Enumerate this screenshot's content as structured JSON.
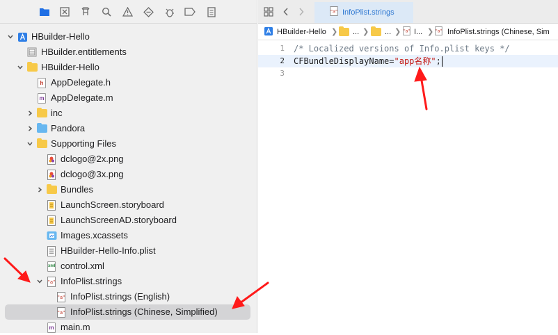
{
  "navigator": {
    "toolbar_icons": [
      "folder-icon",
      "source-control-icon",
      "symbol-icon",
      "search-icon",
      "issue-icon",
      "test-icon",
      "debug-icon",
      "breakpoint-icon",
      "report-icon"
    ],
    "tree": [
      {
        "label": "HBuilder-Hello",
        "icon": "project-icon",
        "expanded": true
      },
      {
        "label": "HBuilder.entitlements",
        "icon": "entitlements-icon"
      },
      {
        "label": "HBuilder-Hello",
        "icon": "folder-icon",
        "expanded": true
      },
      {
        "label": "AppDelegate.h",
        "icon": "header-file-icon",
        "glyph": "h"
      },
      {
        "label": "AppDelegate.m",
        "icon": "objc-file-icon",
        "glyph": "m"
      },
      {
        "label": "inc",
        "icon": "folder-icon",
        "expanded": false
      },
      {
        "label": "Pandora",
        "icon": "blue-folder-icon",
        "expanded": false
      },
      {
        "label": "Supporting Files",
        "icon": "folder-icon",
        "expanded": true
      },
      {
        "label": "dclogo@2x.png",
        "icon": "image-file-icon"
      },
      {
        "label": "dclogo@3x.png",
        "icon": "image-file-icon"
      },
      {
        "label": "Bundles",
        "icon": "folder-icon",
        "expanded": false
      },
      {
        "label": "LaunchScreen.storyboard",
        "icon": "storyboard-icon"
      },
      {
        "label": "LaunchScreenAD.storyboard",
        "icon": "storyboard-icon"
      },
      {
        "label": "Images.xcassets",
        "icon": "asset-catalog-icon"
      },
      {
        "label": "HBuilder-Hello-Info.plist",
        "icon": "plist-icon"
      },
      {
        "label": "control.xml",
        "icon": "xml-file-icon",
        "glyph": "xml"
      },
      {
        "label": "InfoPlist.strings",
        "icon": "strings-file-icon",
        "expanded": true
      },
      {
        "label": "InfoPlist.strings (English)",
        "icon": "strings-file-icon"
      },
      {
        "label": "InfoPlist.strings (Chinese, Simplified)",
        "icon": "strings-file-icon",
        "selected": true
      },
      {
        "label": "main.m",
        "icon": "objc-file-icon",
        "glyph": "m"
      }
    ]
  },
  "editor": {
    "tab": {
      "label": "InfoPlist.strings"
    },
    "jumpbar": {
      "project": "HBuilder-Hello",
      "ellipsis1": "...",
      "ellipsis2": "...",
      "short": "I...",
      "file": "InfoPlist.strings (Chinese, Sim"
    },
    "lines": [
      {
        "n": "1",
        "comment": "/* Localized versions of Info.plist keys */"
      },
      {
        "n": "2",
        "key": "CFBundleDisplayName=",
        "value": "\"app名称\"",
        "end": ";"
      },
      {
        "n": "3"
      }
    ]
  },
  "colors": {
    "annotation_arrow": "#ff1a1a",
    "selection": "#d4d4d6",
    "accent": "#2f78d1",
    "string": "#c41a16"
  }
}
